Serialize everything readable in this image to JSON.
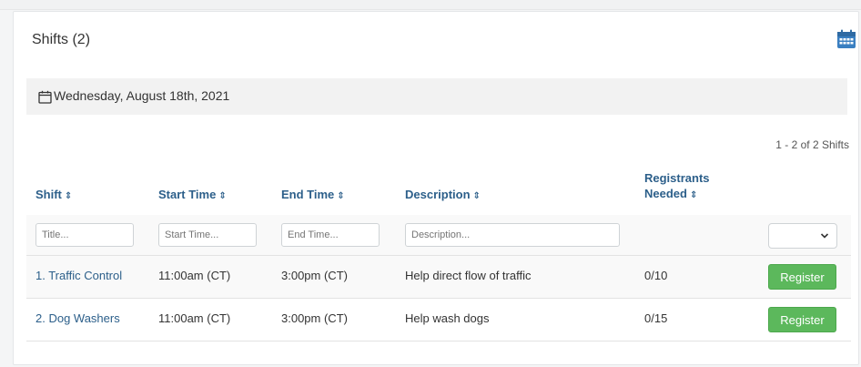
{
  "card": {
    "title": "Shifts (2)",
    "calendar_icon": "calendar-icon"
  },
  "date_bar": {
    "icon": "calendar-outline-icon",
    "label": "Wednesday, August 18th, 2021"
  },
  "pagination": {
    "summary": "1 - 2 of 2 Shifts"
  },
  "table": {
    "headers": [
      {
        "label": "Shift",
        "sort_icon": "⇕"
      },
      {
        "label": "Start Time",
        "sort_icon": "⇕"
      },
      {
        "label": "End Time",
        "sort_icon": "⇕"
      },
      {
        "label": "Description",
        "sort_icon": "⇕"
      },
      {
        "label_line1": "Registrants",
        "label_line2": "Needed",
        "sort_icon": "⇕"
      }
    ],
    "filters": {
      "title_placeholder": "Title...",
      "start_placeholder": "Start Time...",
      "end_placeholder": "End Time...",
      "description_placeholder": "Description..."
    },
    "rows": [
      {
        "shift": "1. Traffic Control",
        "start": "11:00am (CT)",
        "end": "3:00pm (CT)",
        "description": "Help direct flow of traffic",
        "needed": "0/10",
        "button": "Register"
      },
      {
        "shift": "2. Dog Washers",
        "start": "11:00am (CT)",
        "end": "3:00pm (CT)",
        "description": "Help wash dogs",
        "needed": "0/15",
        "button": "Register"
      }
    ]
  },
  "colors": {
    "link": "#2c5f8a",
    "register_button": "#5cb85c",
    "calendar_icon": "#3a7fc1"
  }
}
